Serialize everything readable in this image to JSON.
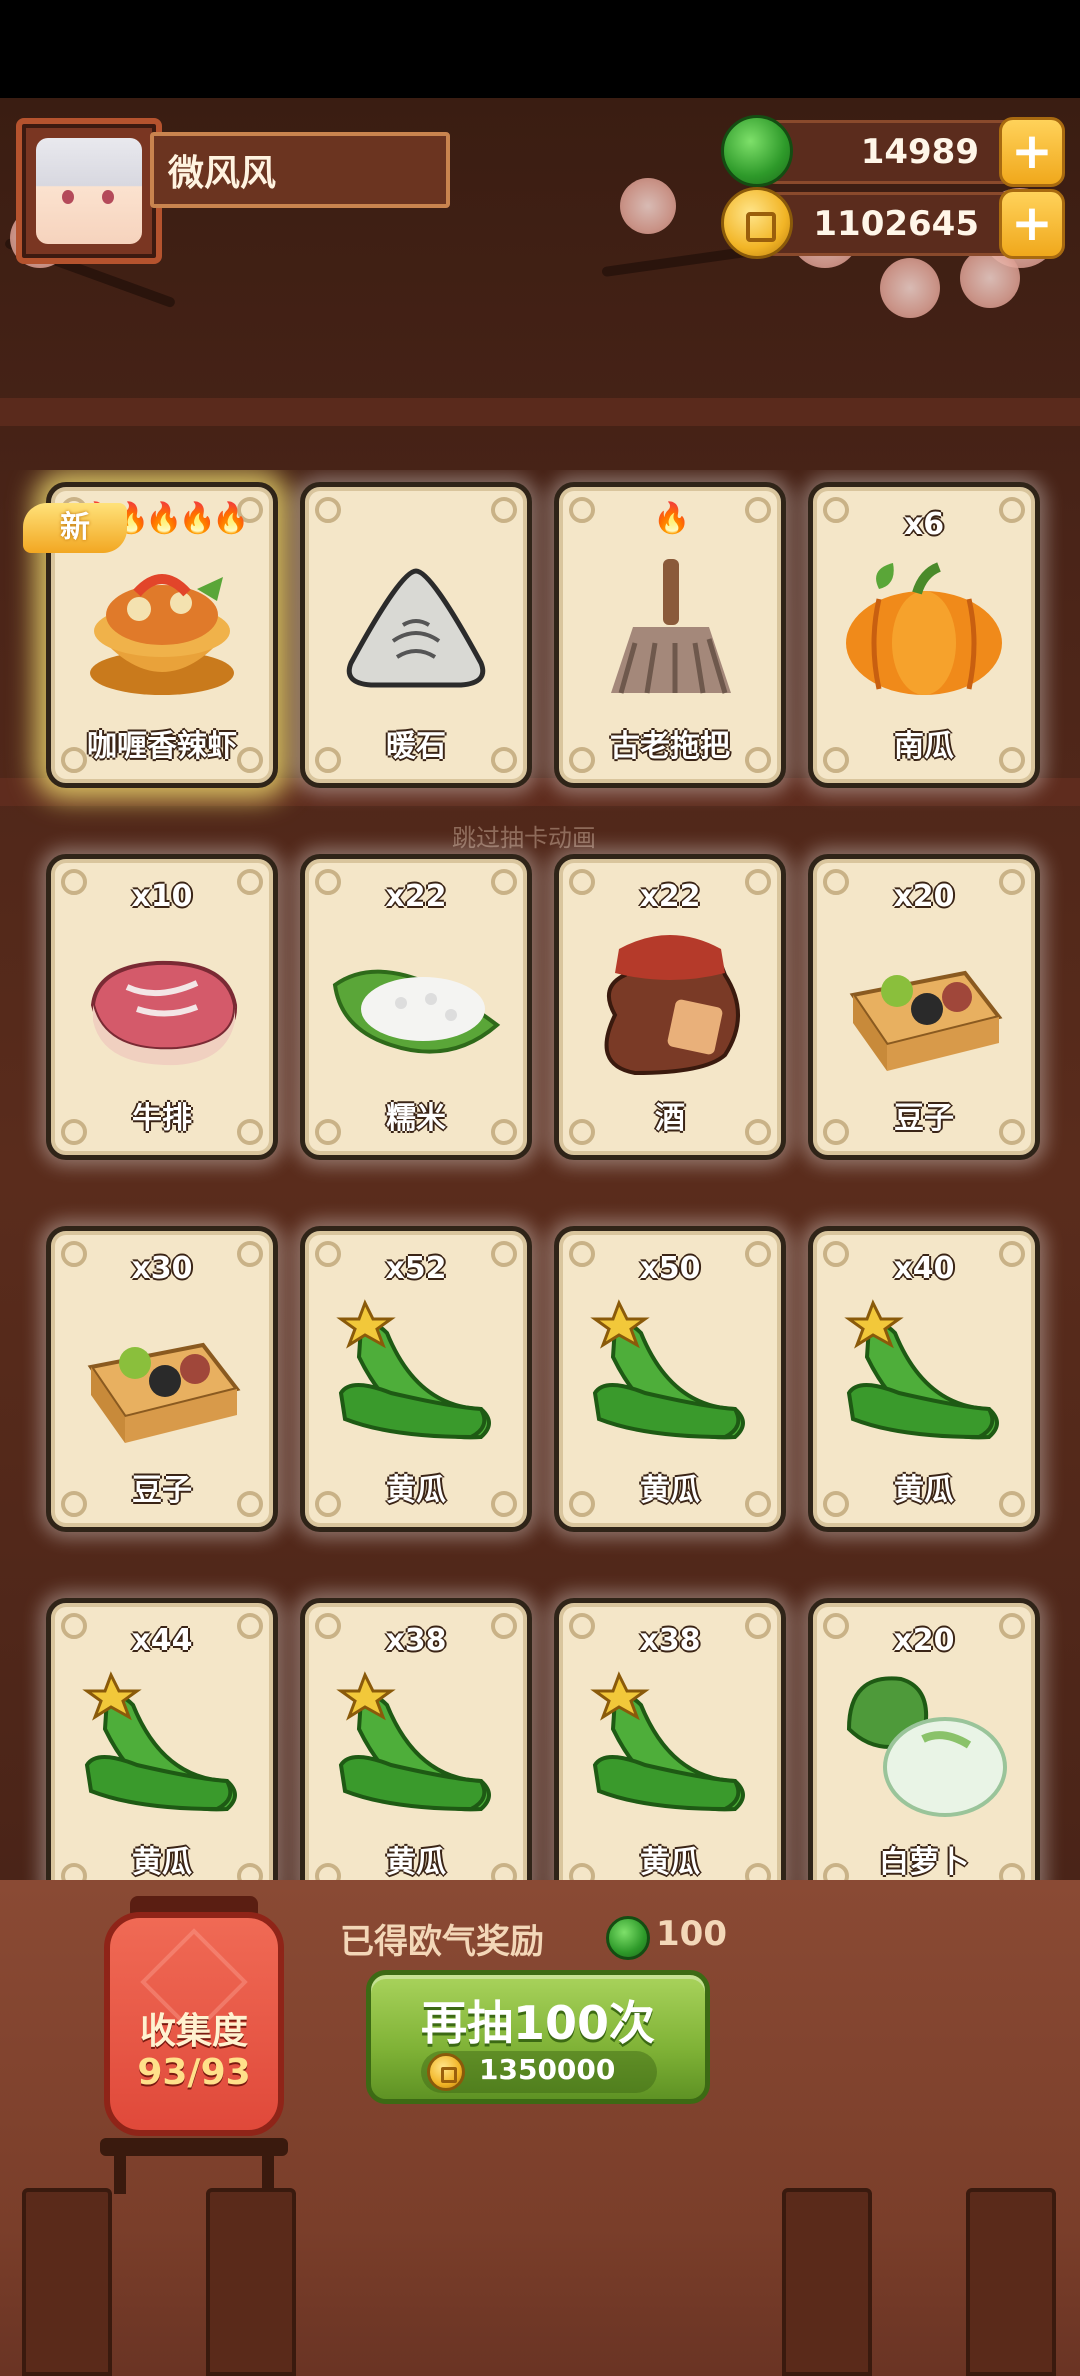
{
  "player": {
    "name": "微风风",
    "gems": "14989",
    "coins": "1102645"
  },
  "cards": [
    {
      "label": "咖喱香辣虾",
      "count": "",
      "flames": "🔥🔥🔥🔥🔥",
      "new_tag": "新",
      "art": "curry-shrimp-icon"
    },
    {
      "label": "暖石",
      "count": "",
      "flames": "",
      "new_tag": "",
      "art": "warm-stone-icon"
    },
    {
      "label": "古老拖把",
      "count": "",
      "flames": "🔥",
      "new_tag": "",
      "art": "old-mop-icon"
    },
    {
      "label": "南瓜",
      "count": "x6",
      "flames": "",
      "new_tag": "",
      "art": "pumpkin-icon"
    },
    {
      "label": "牛排",
      "count": "x10",
      "flames": "",
      "new_tag": "",
      "art": "steak-icon"
    },
    {
      "label": "糯米",
      "count": "x22",
      "flames": "",
      "new_tag": "",
      "art": "rice-icon"
    },
    {
      "label": "酒",
      "count": "x22",
      "flames": "",
      "new_tag": "",
      "art": "wine-jar-icon"
    },
    {
      "label": "豆子",
      "count": "x20",
      "flames": "",
      "new_tag": "",
      "art": "beans-box-icon"
    },
    {
      "label": "豆子",
      "count": "x30",
      "flames": "",
      "new_tag": "",
      "art": "beans-box-icon"
    },
    {
      "label": "黄瓜",
      "count": "x52",
      "flames": "",
      "new_tag": "",
      "art": "cucumber-icon"
    },
    {
      "label": "黄瓜",
      "count": "x50",
      "flames": "",
      "new_tag": "",
      "art": "cucumber-icon"
    },
    {
      "label": "黄瓜",
      "count": "x40",
      "flames": "",
      "new_tag": "",
      "art": "cucumber-icon"
    },
    {
      "label": "黄瓜",
      "count": "x44",
      "flames": "",
      "new_tag": "",
      "art": "cucumber-icon"
    },
    {
      "label": "黄瓜",
      "count": "x38",
      "flames": "",
      "new_tag": "",
      "art": "cucumber-icon"
    },
    {
      "label": "黄瓜",
      "count": "x38",
      "flames": "",
      "new_tag": "",
      "art": "cucumber-icon"
    },
    {
      "label": "白萝卜",
      "count": "x20",
      "flames": "",
      "new_tag": "",
      "art": "radish-icon"
    }
  ],
  "background_text": "跳过抽卡动画",
  "collection": {
    "title": "收集度",
    "value": "93/93"
  },
  "reward": {
    "label": "已得欧气奖励",
    "amount": "100"
  },
  "draw_button": {
    "label": "再抽100次",
    "cost": "1350000"
  },
  "colors": {
    "accent_green": "#7fb236",
    "coin_gold": "#f2b526",
    "card_bg": "#f4e6c8"
  }
}
